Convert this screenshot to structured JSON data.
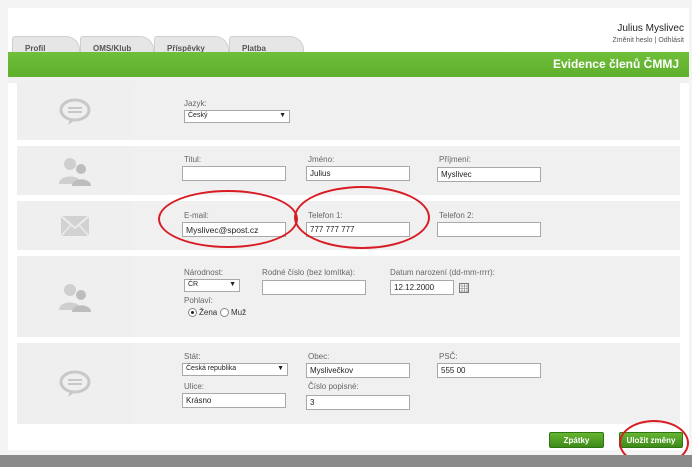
{
  "tabs": [
    {
      "label": "Profil"
    },
    {
      "label": "OMS/Klub"
    },
    {
      "label": "Příspěvky"
    },
    {
      "label": "Platba"
    }
  ],
  "user": {
    "name": "Julius Myslivec",
    "change_password": "Změnit heslo",
    "separator": "|",
    "logout": "Odhlásit"
  },
  "header": {
    "title": "Evidence členů ČMMJ"
  },
  "language": {
    "label": "Jazyk:",
    "value": "Český"
  },
  "name_section": {
    "title_label": "Titul:",
    "title_value": "",
    "first_label": "Jméno:",
    "first_value": "Julius",
    "last_label": "Příjmení:",
    "last_value": "Myslivec"
  },
  "contact": {
    "email_label": "E-mail:",
    "email_value": "Myslivec@spost.cz",
    "phone1_label": "Telefon 1:",
    "phone1_value": "777 777 777",
    "phone2_label": "Telefon 2:",
    "phone2_value": ""
  },
  "personal": {
    "nationality_label": "Národnost:",
    "nationality_value": "ČR",
    "birth_number_label": "Rodné číslo (bez lomítka):",
    "birth_number_value": "",
    "birth_date_label": "Datum narození (dd-mm-rrrr):",
    "birth_date_value": "12.12.2000",
    "gender_label": "Pohlaví:",
    "gender_female": "Žena",
    "gender_male": "Muž"
  },
  "address": {
    "country_label": "Stát:",
    "country_value": "Česká republika",
    "city_label": "Obec:",
    "city_value": "Myslivečkov",
    "zip_label": "PSČ:",
    "zip_value": "555 00",
    "street_label": "Ulice:",
    "street_value": "Krásno",
    "house_label": "Číslo popisné:",
    "house_value": "3"
  },
  "buttons": {
    "back": "Zpátky",
    "save": "Uložit změny"
  },
  "colors": {
    "header_green": "#5fae2d",
    "button_green": "#4c9f22",
    "highlight_red": "#d81c24"
  },
  "icons": {
    "speech": "speech-bubble-icon",
    "users": "users-icon",
    "mail": "envelope-icon",
    "calendar": "calendar-icon"
  }
}
